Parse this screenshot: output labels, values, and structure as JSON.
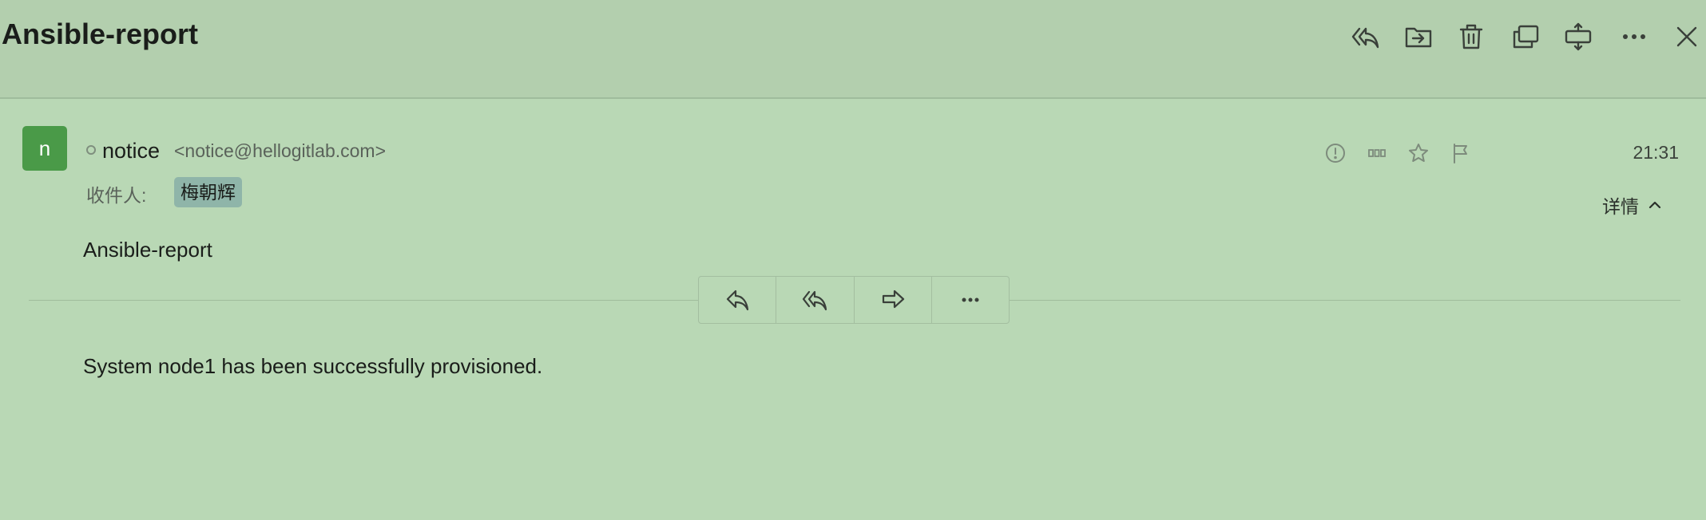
{
  "header": {
    "title": "Ansible-report",
    "toolbar_icons": [
      "reply-all-icon",
      "move-to-folder-icon",
      "trash-icon",
      "new-window-icon",
      "expand-icon",
      "more-icon",
      "close-icon"
    ]
  },
  "message": {
    "avatar_letter": "n",
    "sender_name": "notice",
    "sender_email": "<notice@hellogitlab.com>",
    "time": "21:31",
    "recipient_label": "收件人:",
    "recipient": "梅朝辉",
    "details_label": "详情",
    "subject": "Ansible-report",
    "body": "System node1 has been successfully provisioned.",
    "meta_icons": [
      "important-icon",
      "tag-icon",
      "star-icon",
      "flag-icon"
    ]
  },
  "actions": [
    "reply-icon",
    "reply-all-icon",
    "forward-icon",
    "more-icon"
  ],
  "colors": {
    "background": "#b9d8b5",
    "header_background": "#b3cfae",
    "avatar": "#4a9a48",
    "recipient_chip": "#8fb5a9"
  }
}
